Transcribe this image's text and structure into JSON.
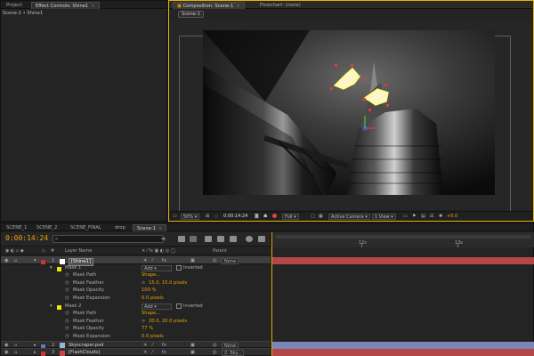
{
  "left_panel": {
    "tabs": [
      {
        "label": "Project"
      },
      {
        "label": "Effect Controls: Shine1"
      }
    ],
    "breadcrumb": "Scene-1 • Shine1"
  },
  "comp_panel": {
    "tabs": [
      {
        "label": "Composition: Scene-1"
      },
      {
        "label": "Flowchart: (none)"
      }
    ],
    "comp_tab": "Scene-1",
    "footer": {
      "zoom": "50%",
      "timecode": "0:00:14:24",
      "resolution": "Full",
      "camera": "Active Camera",
      "views": "1 View",
      "exposure": "+0.0"
    }
  },
  "timeline": {
    "tabs": [
      {
        "label": "SCENE_1"
      },
      {
        "label": "SCENE_2"
      },
      {
        "label": "SCENE_FINAL"
      },
      {
        "label": "drop"
      },
      {
        "label": "Scene-1"
      }
    ],
    "timecode": "0:00:14:24",
    "ruler": {
      "labels": [
        "12s",
        "13s"
      ]
    },
    "columns": {
      "layer_name": "Layer Name",
      "parent": "Parent"
    },
    "rows": [
      {
        "kind": "layer",
        "num": "1",
        "name": "[Shine1]",
        "color": "#cc3333",
        "label_color": "#ffffff",
        "parent": "None",
        "bar_color": "#b24747",
        "selected": true
      },
      {
        "kind": "mask",
        "name": "Mask 1",
        "mode": "Add",
        "inverted": "Inverted",
        "color": "#f2e400"
      },
      {
        "kind": "prop",
        "name": "Mask Path",
        "value": "Shape..."
      },
      {
        "kind": "prop",
        "name": "Mask Feather",
        "value": "15.0, 15.0 pixels"
      },
      {
        "kind": "prop",
        "name": "Mask Opacity",
        "value": "100 %"
      },
      {
        "kind": "prop",
        "name": "Mask Expansion",
        "value": "0.0 pixels"
      },
      {
        "kind": "mask",
        "name": "Mask 2",
        "mode": "Add",
        "inverted": "Inverted",
        "color": "#f2e400"
      },
      {
        "kind": "prop",
        "name": "Mask Path",
        "value": "Shape..."
      },
      {
        "kind": "prop",
        "name": "Mask Feather",
        "value": "20.0, 20.0 pixels"
      },
      {
        "kind": "prop",
        "name": "Mask Opacity",
        "value": "77 %"
      },
      {
        "kind": "prop",
        "name": "Mask Expansion",
        "value": "0.0 pixels"
      },
      {
        "kind": "layer",
        "num": "2",
        "name": "Skyscraper.psd",
        "color": "#5b79c4",
        "label_color": "#9ab0e0",
        "parent": "None",
        "bar_color": "#7b86b8",
        "selected": false
      },
      {
        "kind": "layer",
        "num": "3",
        "name": "[FlashClouds]",
        "color": "#cc3333",
        "label_color": "#cc4444",
        "parent": "2. Sky...",
        "bar_color": "#b24747",
        "selected": false
      }
    ]
  },
  "colors": {
    "accent": "#e8a300",
    "active_panel_border": "#e8b200",
    "mask_outline": "#ffff66",
    "red_bar": "#b24747",
    "blue_bar": "#7b86b8"
  }
}
